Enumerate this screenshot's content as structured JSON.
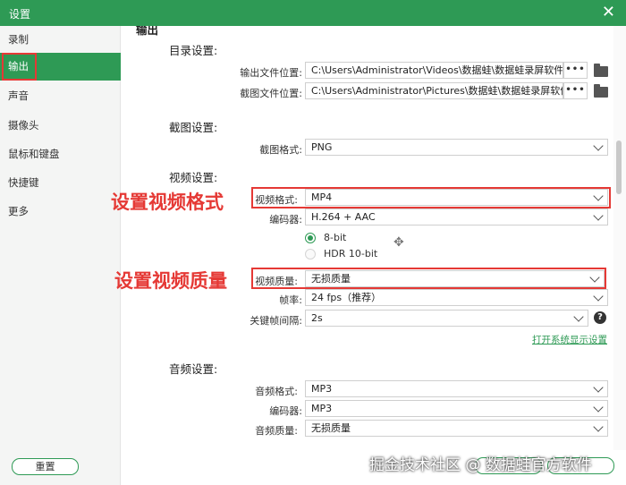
{
  "window": {
    "title": "设置",
    "close_glyph": "✕"
  },
  "sidebar": {
    "items": [
      {
        "label": "录制"
      },
      {
        "label": "输出"
      },
      {
        "label": "声音"
      },
      {
        "label": "摄像头"
      },
      {
        "label": "鼠标和键盘"
      },
      {
        "label": "快捷键"
      },
      {
        "label": "更多"
      }
    ],
    "active": "输出",
    "reset_label": "重置"
  },
  "main": {
    "page_heading": "输出",
    "directory": {
      "title": "目录设置:",
      "output_location_label": "输出文件位置:",
      "output_location_value": "C:\\Users\\Administrator\\Videos\\数据蛙\\数据蛙录屏软件",
      "screenshot_location_label": "截图文件位置:",
      "screenshot_location_value": "C:\\Users\\Administrator\\Pictures\\数据蛙\\数据蛙录屏软件",
      "dots": "•••"
    },
    "screenshot": {
      "title": "截图设置:",
      "format_label": "截图格式:",
      "format_value": "PNG"
    },
    "video": {
      "title": "视频设置:",
      "format_label": "视频格式:",
      "format_value": "MP4",
      "encoder_label": "编码器:",
      "encoder_value": "H.264 + AAC",
      "bit_options": [
        "8-bit",
        "HDR 10-bit"
      ],
      "quality_label": "视频质量:",
      "quality_value": "无损质量",
      "framerate_label": "帧率:",
      "framerate_value": "24 fps（推荐）",
      "keyframe_label": "关键帧间隔:",
      "keyframe_value": "2s",
      "help_glyph": "?",
      "open_display_link": "打开系统显示设置"
    },
    "audio": {
      "title": "音频设置:",
      "format_label": "音频格式:",
      "format_value": "MP3",
      "encoder_label": "编码器:",
      "encoder_value": "MP3",
      "quality_label": "音频质量:",
      "quality_value": "无损质量"
    }
  },
  "annotations": {
    "set_video_format": "设置视频格式",
    "set_video_quality": "设置视频质量"
  },
  "watermark": "掘金技术社区 @ 数据蛙官方软件",
  "colors": {
    "accent": "#2e9a55",
    "annotation": "#e53935"
  }
}
